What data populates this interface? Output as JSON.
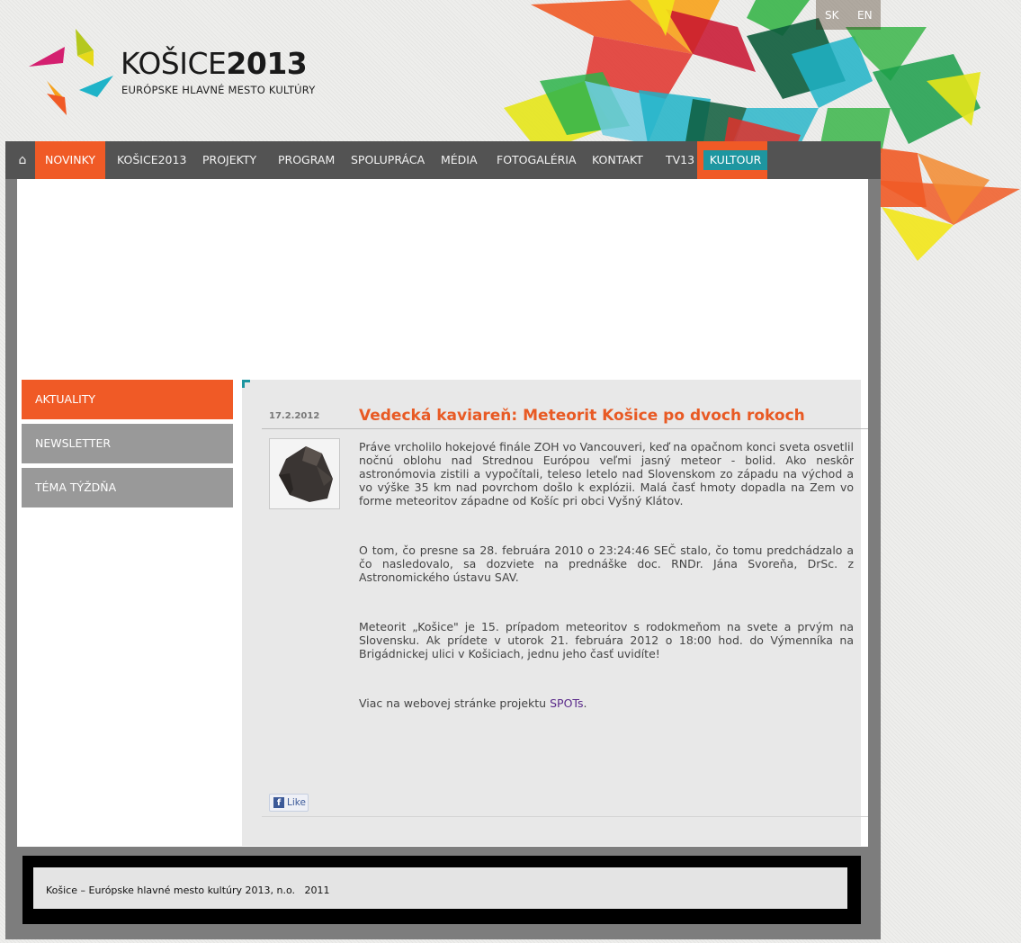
{
  "header": {
    "logo_title_light": "KOŠICE",
    "logo_title_bold": "2013",
    "logo_subtitle": "EURÓPSKE HLAVNÉ MESTO KULTÚRY",
    "languages": [
      "SK",
      "EN"
    ]
  },
  "nav": {
    "home_icon": "⌂",
    "items": [
      "NOVINKY",
      "KOŠICE2013",
      "PROJEKTY",
      "PROGRAM",
      "SPOLUPRÁCA",
      "MÉDIA",
      "FOTOGALÉRIA",
      "KONTAKT",
      "TV13",
      "KULTOUR"
    ],
    "active": "NOVINKY"
  },
  "sidebar": {
    "items": [
      "AKTUALITY",
      "NEWSLETTER",
      "TÉMA TÝŽDŇA"
    ],
    "active": "AKTUALITY"
  },
  "article": {
    "date": "17.2.2012",
    "title": "Vedecká kaviareň: Meteorit Košice po dvoch rokoch",
    "thumbnail_icon": "meteorite-image",
    "paragraphs": [
      "Práve vrcholilo hokejové finále ZOH vo Vancouveri, keď na opačnom konci sveta osvetlil nočnú oblohu nad Strednou Európou veľmi jasný meteor - bolid. Ako neskôr astronómovia zistili a vypočítali, teleso letelo nad Slovenskom zo západu na východ a vo výške 35 km nad povrchom došlo k explózii. Malá časť hmoty dopadla na Zem vo forme meteoritov západne od Košíc pri obci Vyšný Klátov.",
      "O tom, čo presne sa 28. februára 2010 o 23:24:46 SEČ stalo, čo tomu predchádzalo a čo nasledovalo, sa dozviete na prednáške doc. RNDr. Jána Svoreňa, DrSc. z Astronomického ústavu SAV.",
      "Meteorit „Košice\" je 15. prípadom meteoritov s rodokmeňom na svete a prvým na Slovensku. Ak prídete v utorok 21. februára 2012 o 18:00 hod. do Výmenníka na Brigádnickej ulici v Košiciach, jednu jeho časť uvidíte!"
    ],
    "link_prefix": "Viac na webovej stránke projektu ",
    "link_text": "SPOTs",
    "link_suffix": ".",
    "like_icon": "f",
    "like_label": "Like"
  },
  "footer": {
    "text": "Košice – Európske hlavné mesto kultúry 2013, n.o.   2011"
  },
  "colors": {
    "accent_orange": "#f05a26",
    "teal": "#1e96a0",
    "nav_bg": "#484848",
    "sidebar_gray": "#999999"
  }
}
